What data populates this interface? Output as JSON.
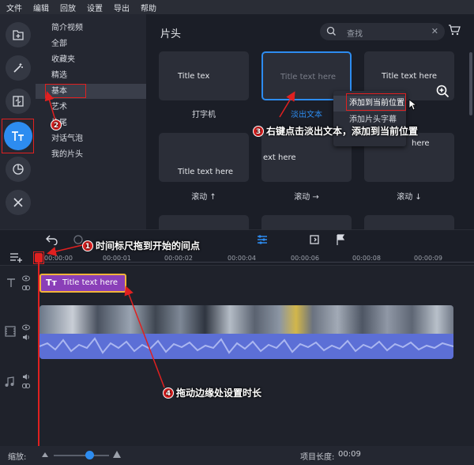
{
  "menu": [
    "文件",
    "编辑",
    "回放",
    "设置",
    "导出",
    "帮助"
  ],
  "categories": [
    "简介视频",
    "全部",
    "收藏夹",
    "精选",
    "基本",
    "艺术",
    "片尾",
    "对话气泡",
    "我的片头"
  ],
  "main": {
    "title": "片头",
    "search_placeholder": "查找",
    "tiles": [
      {
        "text": "Title tex",
        "caption": "打字机"
      },
      {
        "text": "Title text here",
        "caption": "淡出文本"
      },
      {
        "text": "Title text here",
        "caption": ""
      },
      {
        "text": "Title text here",
        "caption": "滚动 ↑"
      },
      {
        "text": "ext here",
        "caption": "滚动 →"
      },
      {
        "text": "here",
        "caption": "滚动 ↓"
      }
    ]
  },
  "context_menu": [
    "添加到当前位置",
    "添加片头字幕"
  ],
  "timeline": {
    "ticks": [
      "00:00:00",
      "00:00:01",
      "00:00:02",
      "00:00:04",
      "00:00:06",
      "00:00:08",
      "00:00:09"
    ],
    "title_clip": "Title text here"
  },
  "annotations": {
    "a1": "时间标尺拖到开始的间点",
    "a2": "",
    "a3": "右键点击淡出文本，添加到当前位置",
    "a4": "拖动边缘处设置时长",
    "n1": "1",
    "n2": "2",
    "n3": "3",
    "n4": "4"
  },
  "bottom": {
    "zoom_label": "缩放:",
    "length_label": "项目长度:",
    "length_value": "00:09"
  },
  "colors": {
    "accent": "#2d8cf0",
    "clip": "#8a3fb8",
    "clip_border": "#f2b43a",
    "audio": "#5c6fd6",
    "annotation": "#e02020"
  }
}
